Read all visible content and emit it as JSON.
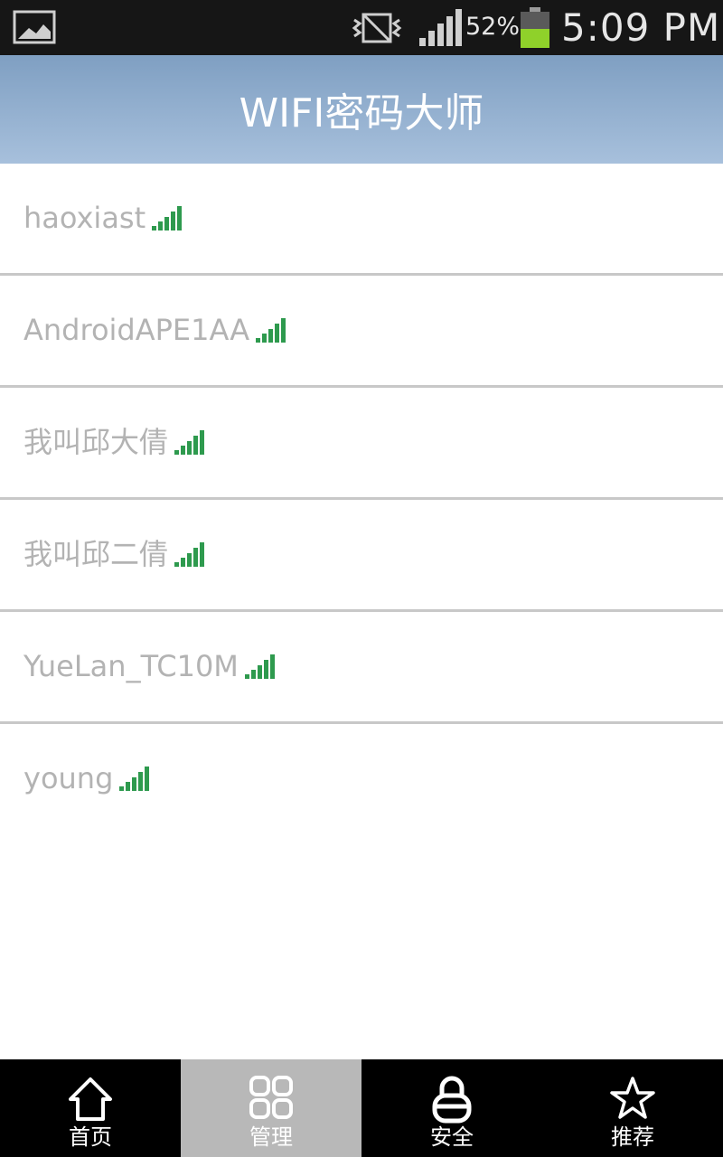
{
  "status_bar": {
    "battery_percent": "52%",
    "time": "5:09 PM",
    "icons": [
      "gallery-icon",
      "vibrate-icon",
      "signal-icon",
      "battery-icon"
    ]
  },
  "header": {
    "title": "WIFI密码大师"
  },
  "networks": [
    {
      "ssid": "haoxiast"
    },
    {
      "ssid": "AndroidAPE1AA"
    },
    {
      "ssid": "我叫邱大倩"
    },
    {
      "ssid": "我叫邱二倩"
    },
    {
      "ssid": "YueLan_TC10M"
    },
    {
      "ssid": "young"
    }
  ],
  "bottom_nav": {
    "items": [
      {
        "label": "首页",
        "icon": "home-icon"
      },
      {
        "label": "管理",
        "icon": "grid-icon"
      },
      {
        "label": "安全",
        "icon": "lock-icon"
      },
      {
        "label": "推荐",
        "icon": "star-icon"
      }
    ],
    "active_index": 1
  },
  "colors": {
    "header_gradient_top": "#7f9fc2",
    "header_gradient_bottom": "#a7c0dc",
    "signal_green": "#2e9a4e",
    "active_tab": "#b8b8b8"
  }
}
